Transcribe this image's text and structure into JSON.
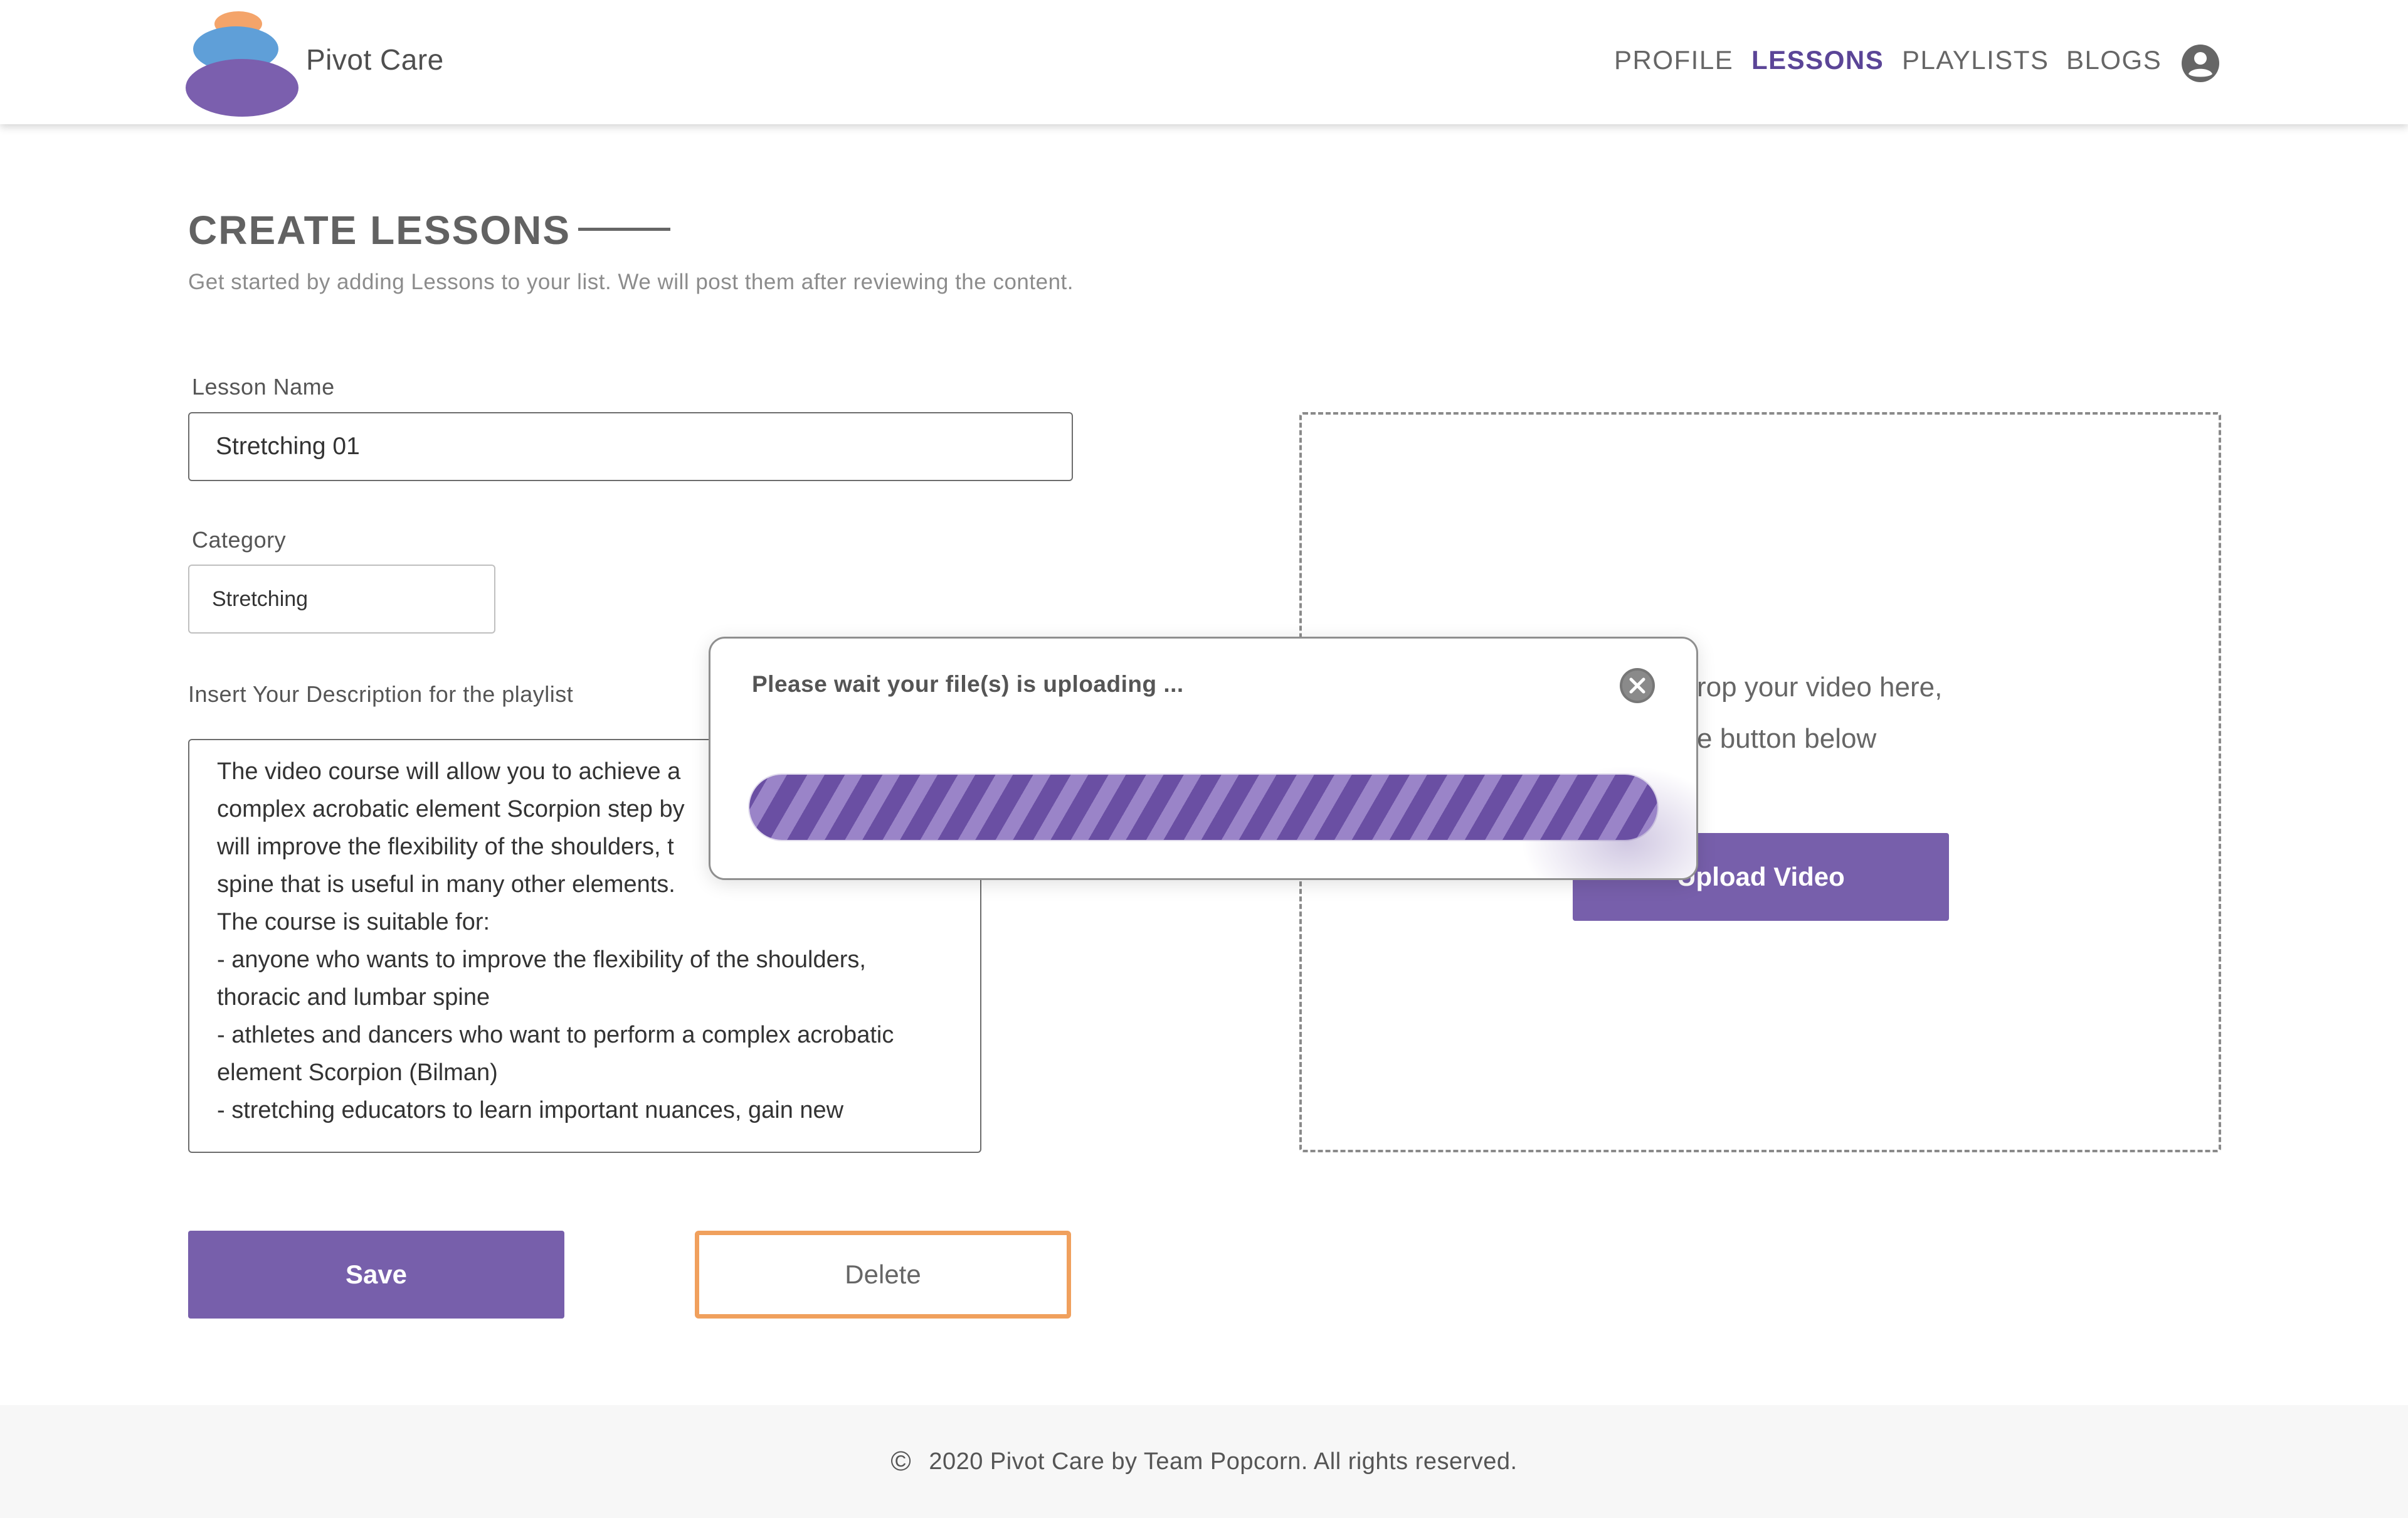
{
  "header": {
    "brand": "Pivot Care",
    "nav": [
      {
        "label": "PROFILE",
        "active": false
      },
      {
        "label": "LESSONS",
        "active": true
      },
      {
        "label": "PLAYLISTS",
        "active": false
      },
      {
        "label": "BLOGS",
        "active": false
      }
    ],
    "user_icon": "account-circle-icon"
  },
  "page": {
    "title": "CREATE LESSONS",
    "subtitle": "Get started by adding Lessons to your list. We will post them after reviewing the content."
  },
  "form": {
    "lesson_name_label": "Lesson Name",
    "lesson_name_value": "Stretching 01",
    "category_label": "Category",
    "category_value": "Stretching",
    "description_label": "Insert Your Description for the playlist",
    "description_value": "The video course will allow you to achieve a\ncomplex acrobatic element Scorpion step by\nwill improve the flexibility of the shoulders, t\nspine that is useful in many other elements.\nThe course is suitable for:\n- anyone who wants to improve the flexibility of the shoulders,\nthoracic and lumbar spine\n- athletes and dancers who want to perform a complex acrobatic\nelement Scorpion (Bilman)\n- stretching educators to learn important nuances, gain new",
    "save_label": "Save",
    "delete_label": "Delete"
  },
  "dropzone": {
    "line1": "rop your video here,",
    "line2": "e button below",
    "upload_label": "Upload Video"
  },
  "modal": {
    "message": "Please wait your file(s) is uploading ...",
    "close_icon": "close-circle-icon",
    "progress_fraction": 1.0
  },
  "footer": {
    "copyright_icon": "copyright-icon",
    "text": "2020 Pivot Care by Team Popcorn. All rights reserved."
  },
  "colors": {
    "accent": "#775fab",
    "nav_active": "#5b4597",
    "delete_border": "#f0a05d"
  }
}
